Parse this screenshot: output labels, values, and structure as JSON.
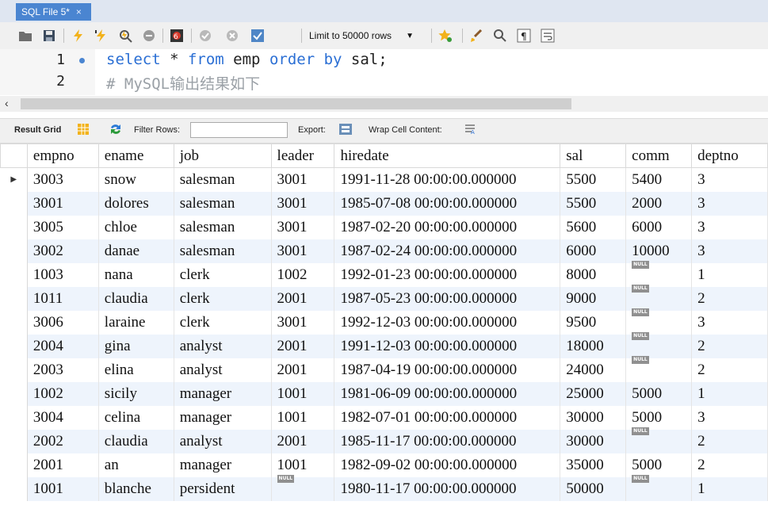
{
  "tab": {
    "title": "SQL File 5*",
    "close": "×"
  },
  "toolbar": {
    "limit_label": "Limit to 50000 rows"
  },
  "editor": {
    "lines": [
      {
        "num": "1",
        "parts": [
          "select",
          " * ",
          "from",
          " emp ",
          "order by",
          " sal;"
        ]
      },
      {
        "num": "2",
        "comment": "# MySQL输出结果如下"
      }
    ]
  },
  "resultbar": {
    "grid_label": "Result Grid",
    "filter_label": "Filter Rows:",
    "filter_value": "",
    "export_label": "Export:",
    "wrap_label": "Wrap Cell Content:"
  },
  "grid": {
    "columns": [
      "empno",
      "ename",
      "job",
      "leader",
      "hiredate",
      "sal",
      "comm",
      "deptno"
    ],
    "null_label": "NULL",
    "current_row_marker": "▶",
    "rows": [
      [
        "3003",
        "snow",
        "salesman",
        "3001",
        "1991-11-28 00:00:00.000000",
        "5500",
        "5400",
        "3"
      ],
      [
        "3001",
        "dolores",
        "salesman",
        "3001",
        "1985-07-08 00:00:00.000000",
        "5500",
        "2000",
        "3"
      ],
      [
        "3005",
        "chloe",
        "salesman",
        "3001",
        "1987-02-20 00:00:00.000000",
        "5600",
        "6000",
        "3"
      ],
      [
        "3002",
        "danae",
        "salesman",
        "3001",
        "1987-02-24 00:00:00.000000",
        "6000",
        "10000",
        "3"
      ],
      [
        "1003",
        "nana",
        "clerk",
        "1002",
        "1992-01-23 00:00:00.000000",
        "8000",
        null,
        "1"
      ],
      [
        "1011",
        "claudia",
        "clerk",
        "2001",
        "1987-05-23 00:00:00.000000",
        "9000",
        null,
        "2"
      ],
      [
        "3006",
        "laraine",
        "clerk",
        "3001",
        "1992-12-03 00:00:00.000000",
        "9500",
        null,
        "3"
      ],
      [
        "2004",
        "gina",
        "analyst",
        "2001",
        "1991-12-03 00:00:00.000000",
        "18000",
        null,
        "2"
      ],
      [
        "2003",
        "elina",
        "analyst",
        "2001",
        "1987-04-19 00:00:00.000000",
        "24000",
        null,
        "2"
      ],
      [
        "1002",
        "sicily",
        "manager",
        "1001",
        "1981-06-09 00:00:00.000000",
        "25000",
        "5000",
        "1"
      ],
      [
        "3004",
        "celina",
        "manager",
        "1001",
        "1982-07-01 00:00:00.000000",
        "30000",
        "5000",
        "3"
      ],
      [
        "2002",
        "claudia",
        "analyst",
        "2001",
        "1985-11-17 00:00:00.000000",
        "30000",
        null,
        "2"
      ],
      [
        "2001",
        "an",
        "manager",
        "1001",
        "1982-09-02 00:00:00.000000",
        "35000",
        "5000",
        "2"
      ],
      [
        "1001",
        "blanche",
        "persident",
        null,
        "1980-11-17 00:00:00.000000",
        "50000",
        null,
        "1"
      ]
    ]
  }
}
